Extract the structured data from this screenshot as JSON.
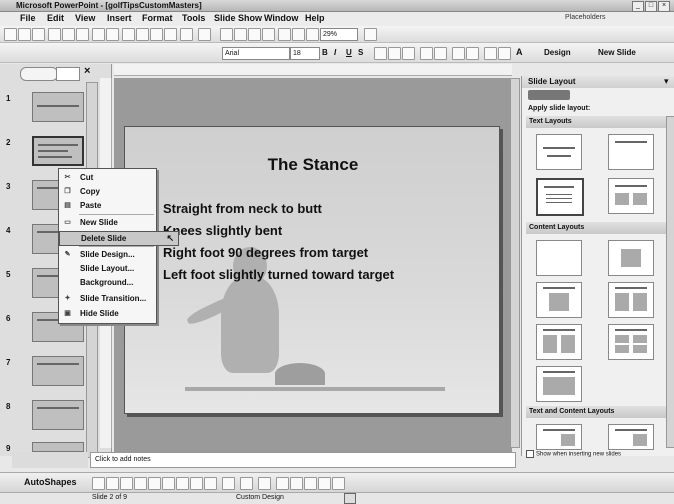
{
  "window": {
    "title": "Microsoft PowerPoint - [golfTipsCustomMasters]"
  },
  "menu": [
    "File",
    "Edit",
    "View",
    "Insert",
    "Format",
    "Tools",
    "Slide Show",
    "Window",
    "Help"
  ],
  "toolbar": {
    "zoom": "29%",
    "font_name": "Arial",
    "font_size": "18",
    "placeholders_label": "Placeholders",
    "design_label": "Design",
    "new_slide_label": "New Slide",
    "bold": "B",
    "italic": "I",
    "underline": "U",
    "shadow": "S"
  },
  "slides_pane": {
    "tab_close": "×",
    "slide_numbers": [
      "1",
      "2",
      "3",
      "4",
      "5",
      "6",
      "7",
      "8",
      "9"
    ]
  },
  "slide": {
    "title": "The Stance",
    "bullets": [
      "Straight from neck to butt",
      "Knees slightly bent",
      "Right foot 90 degrees from target",
      "Left foot slightly turned toward target"
    ]
  },
  "context_menu": {
    "items": [
      "Cut",
      "Copy",
      "Paste",
      "New Slide",
      "Delete Slide",
      "Slide Design...",
      "Slide Layout...",
      "Background...",
      "Slide Transition...",
      "Hide Slide"
    ],
    "highlighted": "Delete Slide"
  },
  "task_pane": {
    "title": "Slide Layout",
    "apply_label": "Apply slide layout:",
    "sections": [
      "Text Layouts",
      "Content Layouts",
      "Text and Content Layouts"
    ],
    "show_checkbox": "Show when inserting new slides"
  },
  "notes": {
    "placeholder": "Click to add notes"
  },
  "drawing": {
    "autoshapes": "AutoShapes"
  },
  "status": {
    "slide_indicator": "Slide 2 of 9",
    "design_name": "Custom Design"
  }
}
